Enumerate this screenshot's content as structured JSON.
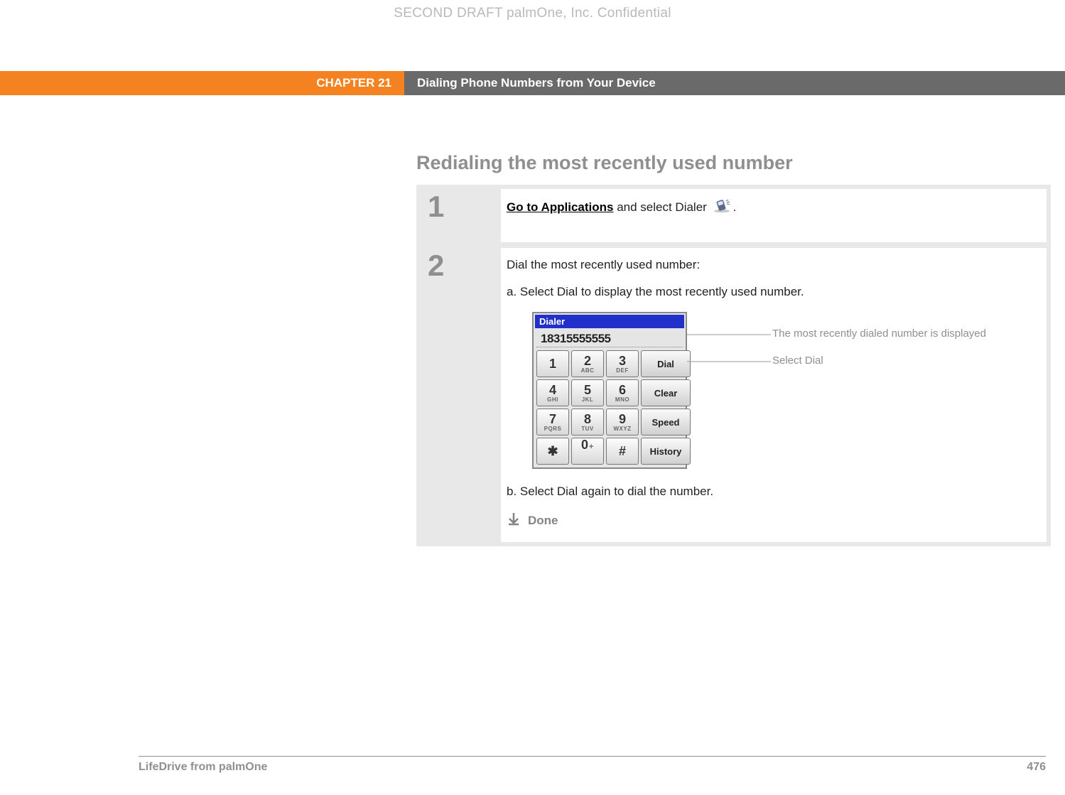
{
  "watermark": "SECOND DRAFT palmOne, Inc.  Confidential",
  "header": {
    "chapter": "CHAPTER 21",
    "title": "Dialing Phone Numbers from Your Device"
  },
  "section_heading": "Redialing the most recently used number",
  "step1": {
    "number": "1",
    "link_text": "Go to Applications",
    "trail_text": " and select Dialer ",
    "period": "."
  },
  "step2": {
    "number": "2",
    "intro": "Dial the most recently used number:",
    "item_a": "a.  Select Dial to display the most recently used number.",
    "item_b": "b.  Select Dial again to dial the number.",
    "done_label": "Done"
  },
  "dialer": {
    "title": "Dialer",
    "display": "18315555555",
    "keys": {
      "k1": {
        "big": "1",
        "sub": ""
      },
      "k2": {
        "big": "2",
        "sub": "ABC"
      },
      "k3": {
        "big": "3",
        "sub": "DEF"
      },
      "k4": {
        "big": "4",
        "sub": "GHI"
      },
      "k5": {
        "big": "5",
        "sub": "JKL"
      },
      "k6": {
        "big": "6",
        "sub": "MNO"
      },
      "k7": {
        "big": "7",
        "sub": "PQRS"
      },
      "k8": {
        "big": "8",
        "sub": "TUV"
      },
      "k9": {
        "big": "9",
        "sub": "WXYZ"
      },
      "kstar": {
        "big": "✱",
        "sub": ""
      },
      "k0": {
        "big": "0",
        "sub": "+"
      },
      "khash": {
        "big": "#",
        "sub": ""
      }
    },
    "buttons": {
      "dial": "Dial",
      "clear": "Clear",
      "speed": "Speed",
      "history": "History"
    }
  },
  "callouts": {
    "display": "The most recently dialed number is displayed",
    "dial": "Select Dial"
  },
  "footer": {
    "product": "LifeDrive from palmOne",
    "page": "476"
  }
}
